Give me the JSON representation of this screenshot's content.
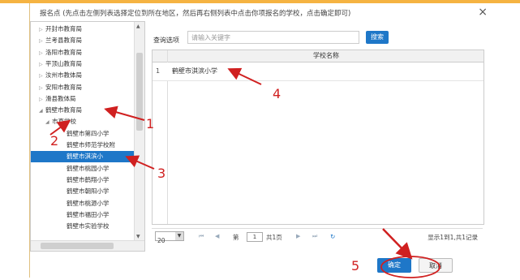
{
  "dialog": {
    "title": "报名点 (先点击左侧列表选择定位到所在地区，然后再右侧列表中点击你项报名的学校，点击确定即可)",
    "close_glyph": "×"
  },
  "tree": {
    "items": [
      {
        "label": "开封市教育局",
        "arrow": "▷"
      },
      {
        "label": "兰考县教育局",
        "arrow": "▷"
      },
      {
        "label": "洛阳市教育局",
        "arrow": "▷"
      },
      {
        "label": "平顶山教育局",
        "arrow": "▷"
      },
      {
        "label": "汝州市教体局",
        "arrow": "▷"
      },
      {
        "label": "安阳市教育局",
        "arrow": "▷"
      },
      {
        "label": "滑县教体局",
        "arrow": "▷"
      },
      {
        "label": "鹤壁市教育局",
        "arrow": "◢"
      },
      {
        "label": "市直学校",
        "arrow": "◢"
      },
      {
        "label": "鹤壁市第四小学",
        "arrow": ""
      },
      {
        "label": "鹤壁市师范学校附",
        "arrow": ""
      },
      {
        "label": "鹤壁市淇滨小",
        "arrow": ""
      },
      {
        "label": "鹤壁市桃园小学",
        "arrow": ""
      },
      {
        "label": "鹤壁市鹤翔小学",
        "arrow": ""
      },
      {
        "label": "鹤壁市朝阳小学",
        "arrow": ""
      },
      {
        "label": "鹤壁市桃源小学",
        "arrow": ""
      },
      {
        "label": "鹤壁市福田小学",
        "arrow": ""
      },
      {
        "label": "鹤壁市实验学校",
        "arrow": ""
      }
    ],
    "selected_index": 11
  },
  "query": {
    "label": "查询选项",
    "placeholder": "请输入关键字",
    "button_label": "搜索"
  },
  "grid": {
    "column_header": "学校名称",
    "rows": [
      {
        "num": "1",
        "name": "鹤壁市淇滨小学"
      }
    ]
  },
  "pager": {
    "page_size": "20",
    "page_prefix": "第",
    "current_page": "1",
    "page_suffix": "共1页",
    "summary": "显示1到1,共1记录",
    "first_glyph": "⏮",
    "prev_glyph": "◀",
    "next_glyph": "▶",
    "last_glyph": "⏭",
    "refresh_glyph": "↻"
  },
  "footer": {
    "ok_label": "确定",
    "cancel_label": "取消"
  },
  "annotations": {
    "labels": [
      "1",
      "2",
      "3",
      "4",
      "5"
    ],
    "color": "#d02020"
  },
  "colors": {
    "accent": "#1e77c8",
    "top_bar": "#f5b342"
  }
}
